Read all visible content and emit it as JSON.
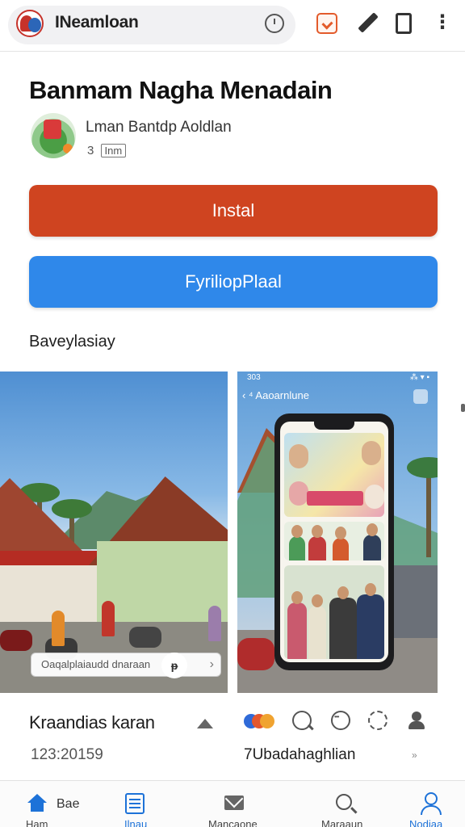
{
  "browser": {
    "url_label": "INeamloan",
    "icons": [
      "logo-icon",
      "clock-icon",
      "tab-icon",
      "pen-icon",
      "document-icon",
      "more-icon"
    ],
    "more_label": "⋮"
  },
  "app": {
    "title": "Banmam Nagha Menadain",
    "developer": "Lman Bantdp Aoldlan",
    "meta_count": "3",
    "meta_badge": "Inm"
  },
  "buttons": {
    "install_label": "Instal",
    "secondary_label": "FyriliopPlaal"
  },
  "section": {
    "label": "Baveylasiay"
  },
  "screenshots": {
    "shot1_search": "Oaqalplaiaudd dnaraan",
    "shot2_status_left": "303",
    "shot2_status_right": "⁂ ▾ ▪",
    "shot2_back_label": "‹ ⁴ Aaoarnlune",
    "shot2_badge": "ᵽ"
  },
  "details": {
    "left_title": "Kraandias karan",
    "left_sub": "123:20159",
    "right_sub": "7Ubadahaghlian",
    "chevron": "»"
  },
  "nav": {
    "home_label": "Bae",
    "items": [
      {
        "label": "Ham"
      },
      {
        "label": "Ilnau"
      },
      {
        "label": "Mancaone"
      },
      {
        "label": "Maraaun"
      },
      {
        "label": "Nodiaa"
      }
    ]
  },
  "colors": {
    "install": "#cf4420",
    "secondary": "#2f88ea",
    "accent": "#1d72d8"
  }
}
